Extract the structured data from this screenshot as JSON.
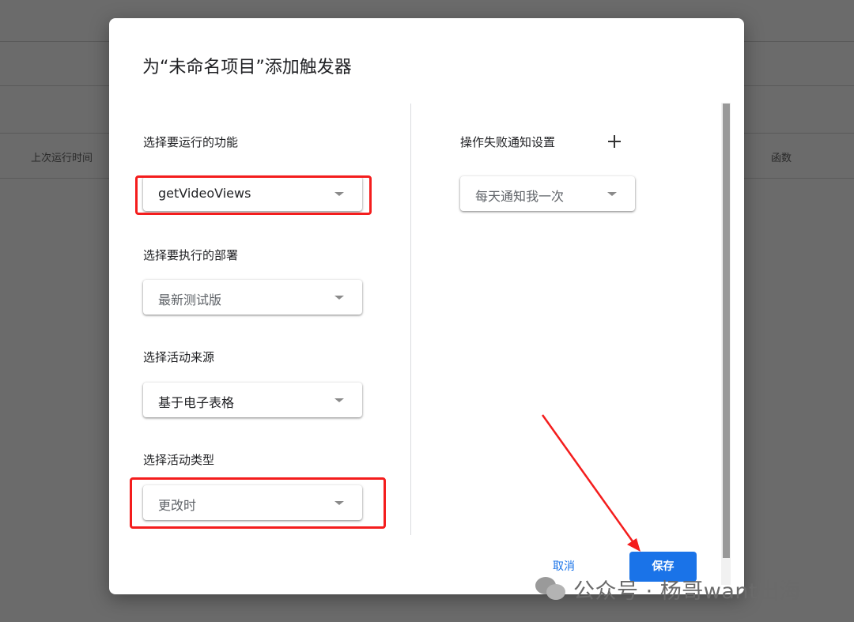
{
  "background": {
    "col_last_run": "上次运行时间",
    "col_function": "函数"
  },
  "dialog": {
    "title": "为“未命名项目”添加触发器",
    "function_section": {
      "label": "选择要运行的功能",
      "value": "getVideoViews"
    },
    "deployment_section": {
      "label": "选择要执行的部署",
      "value": "最新测试版"
    },
    "event_source_section": {
      "label": "选择活动来源",
      "value": "基于电子表格"
    },
    "event_type_section": {
      "label": "选择活动类型",
      "value": "更改时"
    },
    "failure_notification": {
      "label": "操作失败通知设置",
      "value": "每天通知我一次"
    },
    "buttons": {
      "cancel": "取消",
      "save": "保存"
    }
  },
  "watermark": {
    "text": "公众号 · 杨哥want出海"
  },
  "colors": {
    "accent": "#1a73e8",
    "highlight": "#f41d1d",
    "overlay": "#6b6b6b"
  },
  "icons": [
    "chevron-down-icon",
    "plus-icon",
    "wechat-logo-icon",
    "arrow-annotation-icon"
  ]
}
